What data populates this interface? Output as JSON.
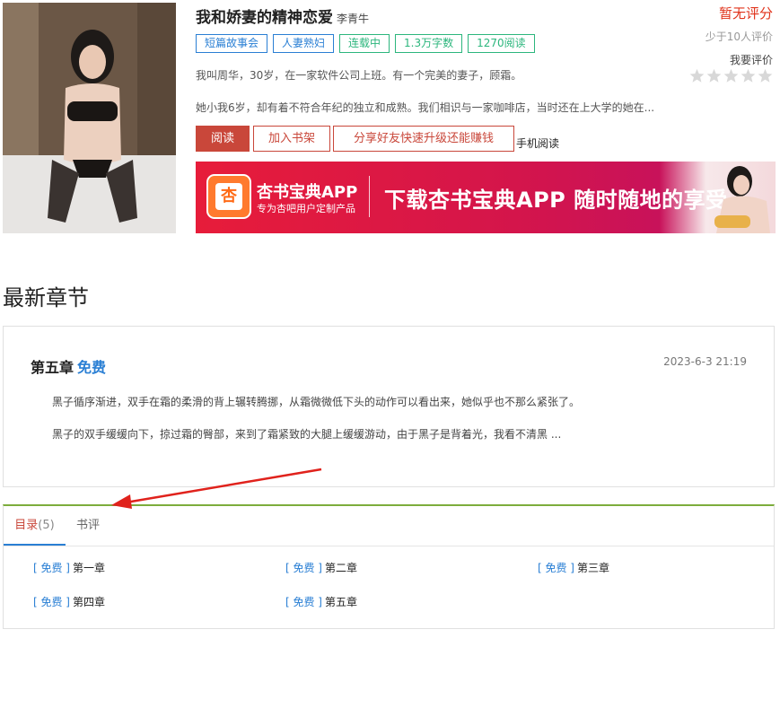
{
  "book": {
    "title": "我和娇妻的精神恋爱",
    "author": "李青牛",
    "tags": [
      {
        "label": "短篇故事会",
        "color": "blue"
      },
      {
        "label": "人妻熟妇",
        "color": "blue"
      },
      {
        "label": "连载中",
        "color": "green"
      },
      {
        "label": "1.3万字数",
        "color": "green"
      },
      {
        "label": "1270阅读",
        "color": "green"
      }
    ],
    "intro_line1": "我叫周华，30岁，在一家软件公司上班。有一个完美的妻子，顾霜。",
    "intro_line2": "她小我6岁，却有着不符合年纪的独立和成熟。我们相识与一家咖啡店，当时还在上大学的她在..."
  },
  "rating": {
    "score_text": "暂无评分",
    "reviewers_text": "少于10人评价",
    "rate_label": "我要评价",
    "stars_total": 5,
    "stars_filled": 0
  },
  "actions": {
    "read": "阅读",
    "add_shelf": "加入书架",
    "share": "分享好友快速升级还能赚钱",
    "mobile_read": "手机阅读"
  },
  "banner": {
    "logo_glyph": "杏",
    "app_name": "杏书宝典APP",
    "tagline": "专为杏吧用户定制产品",
    "slogan": "下载杏书宝典APP 随时随地的享受"
  },
  "latest": {
    "heading": "最新章节",
    "chapter_title": "第五章",
    "free_label": "免费",
    "date": "2023-6-3 21:19",
    "paragraph1": "黑子循序渐进，双手在霜的柔滑的背上辗转腾挪，从霜微微低下头的动作可以看出来，她似乎也不那么紧张了。",
    "paragraph2": "黑子的双手缓缓向下，掠过霜的臀部，来到了霜紧致的大腿上缓缓游动，由于黑子是背着光，我看不清黑 ..."
  },
  "tabs": {
    "toc_label": "目录",
    "toc_count": "(5)",
    "review_label": "书评"
  },
  "chapters": [
    {
      "free": "[ 免费 ]",
      "title": "第一章"
    },
    {
      "free": "[ 免费 ]",
      "title": "第二章"
    },
    {
      "free": "[ 免费 ]",
      "title": "第三章"
    },
    {
      "free": "[ 免费 ]",
      "title": "第四章"
    },
    {
      "free": "[ 免费 ]",
      "title": "第五章"
    }
  ],
  "colors": {
    "accent_red": "#c9473a",
    "link_blue": "#2a7fd4",
    "tag_green": "#2cb67d",
    "divider_green": "#7cad3c",
    "arrow_red": "#e0221c"
  }
}
